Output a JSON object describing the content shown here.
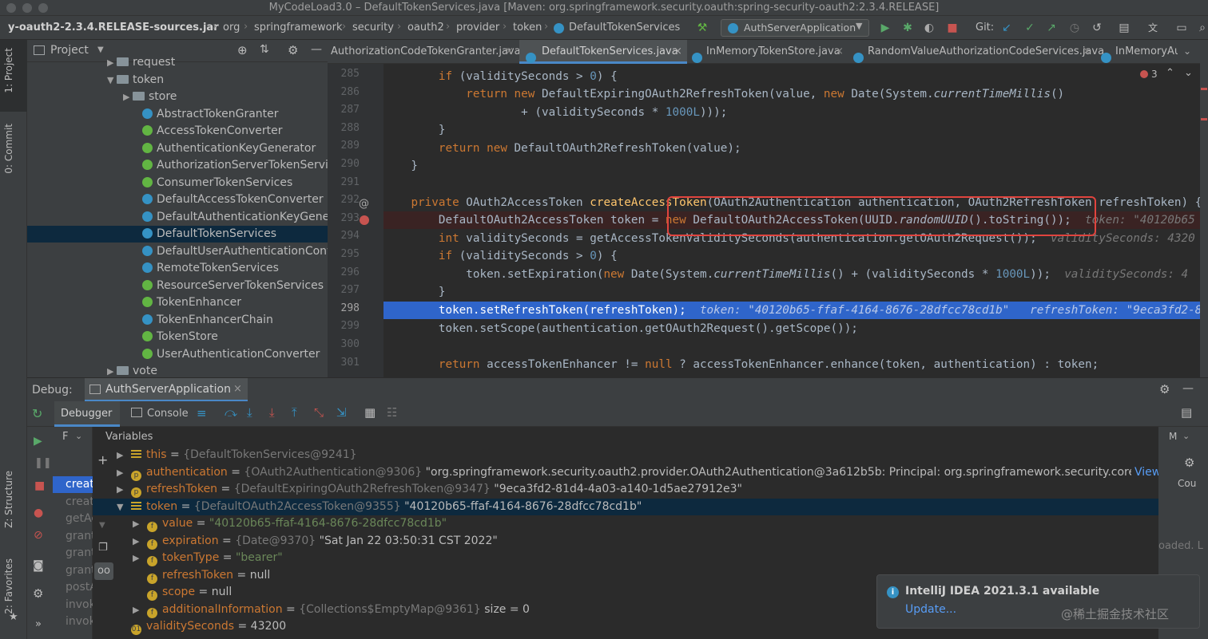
{
  "window": {
    "title": "MyCodeLoad3.0 – DefaultTokenServices.java [Maven: org.springframework.security.oauth:spring-security-oauth2:2.3.4.RELEASE]"
  },
  "breadcrumbs": [
    "y-oauth2-2.3.4.RELEASE-sources.jar",
    "org",
    "springframework",
    "security",
    "oauth2",
    "provider",
    "token",
    "DefaultTokenServices"
  ],
  "toolbar": {
    "run_config": "AuthServerApplication",
    "git_label": "Git:"
  },
  "side_tabs": {
    "project": "1: Project",
    "commit": "0: Commit",
    "structure": "Z: Structure",
    "favorites": "2: Favorites"
  },
  "project": {
    "title": "Project",
    "tree": [
      {
        "label": "request",
        "type": "folder",
        "indent": 1,
        "arrow": "▶"
      },
      {
        "label": "token",
        "type": "folder",
        "indent": 1,
        "arrow": "▼"
      },
      {
        "label": "store",
        "type": "folder",
        "indent": 2,
        "arrow": "▶"
      },
      {
        "label": "AbstractTokenGranter",
        "type": "class",
        "indent": 3
      },
      {
        "label": "AccessTokenConverter",
        "type": "interface",
        "indent": 3
      },
      {
        "label": "AuthenticationKeyGenerator",
        "type": "interface",
        "indent": 3
      },
      {
        "label": "AuthorizationServerTokenServic",
        "type": "interface",
        "indent": 3
      },
      {
        "label": "ConsumerTokenServices",
        "type": "interface",
        "indent": 3
      },
      {
        "label": "DefaultAccessTokenConverter",
        "type": "class",
        "indent": 3
      },
      {
        "label": "DefaultAuthenticationKeyGener",
        "type": "class",
        "indent": 3
      },
      {
        "label": "DefaultTokenServices",
        "type": "class",
        "indent": 3,
        "selected": true
      },
      {
        "label": "DefaultUserAuthenticationConv",
        "type": "class",
        "indent": 3
      },
      {
        "label": "RemoteTokenServices",
        "type": "class",
        "indent": 3
      },
      {
        "label": "ResourceServerTokenServices",
        "type": "interface",
        "indent": 3
      },
      {
        "label": "TokenEnhancer",
        "type": "interface",
        "indent": 3
      },
      {
        "label": "TokenEnhancerChain",
        "type": "class",
        "indent": 3
      },
      {
        "label": "TokenStore",
        "type": "interface",
        "indent": 3
      },
      {
        "label": "UserAuthenticationConverter",
        "type": "interface",
        "indent": 3
      },
      {
        "label": "vote",
        "type": "folder",
        "indent": 1,
        "arrow": "▶"
      }
    ]
  },
  "editor": {
    "tabs": [
      {
        "label": "AuthorizationCodeTokenGranter.java",
        "active": false
      },
      {
        "label": "DefaultTokenServices.java",
        "active": true
      },
      {
        "label": "InMemoryTokenStore.java",
        "active": false
      },
      {
        "label": "RandomValueAuthorizationCodeServices.java",
        "active": false
      },
      {
        "label": "InMemoryAu",
        "active": false
      }
    ],
    "warning_count": "3",
    "line_numbers": [
      "285",
      "286",
      "287",
      "288",
      "289",
      "290",
      "291",
      "292",
      "293",
      "294",
      "295",
      "296",
      "297",
      "298",
      "299",
      "300",
      "301"
    ],
    "current_line": "298",
    "breakpoint_line": "293"
  },
  "debug": {
    "label": "Debug:",
    "session": "AuthServerApplication",
    "tabs": {
      "debugger": "Debugger",
      "console": "Console"
    },
    "variables_title": "Variables",
    "frames_header": "F",
    "frames": [
      "creat",
      "creat",
      "getAc",
      "grant",
      "grant",
      "grant",
      "postA",
      "invok",
      "invok"
    ],
    "variables": [
      {
        "indent": 0,
        "arrow": "▶",
        "icon": "list",
        "name": "this",
        "type": "{DefaultTokenServices@9241}",
        "value": ""
      },
      {
        "indent": 0,
        "arrow": "▶",
        "icon": "p",
        "name": "authentication",
        "type": "{OAuth2Authentication@9306}",
        "value": "\"org.springframework.security.oauth2.provider.OAuth2Authentication@3a612b5b: Principal: org.springframework.security.core.u...",
        "link": "View"
      },
      {
        "indent": 0,
        "arrow": "▶",
        "icon": "p",
        "name": "refreshToken",
        "type": "{DefaultExpiringOAuth2RefreshToken@9347}",
        "value": "\"9eca3fd2-81d4-4a03-a140-1d5ae27912e3\""
      },
      {
        "indent": 0,
        "arrow": "▼",
        "icon": "list",
        "name": "token",
        "type": "{DefaultOAuth2AccessToken@9355}",
        "value": "\"40120b65-ffaf-4164-8676-28dfcc78cd1b\"",
        "selected": true
      },
      {
        "indent": 1,
        "arrow": "▶",
        "icon": "f",
        "name": "value",
        "type": "",
        "value": "\"40120b65-ffaf-4164-8676-28dfcc78cd1b\"",
        "green": true
      },
      {
        "indent": 1,
        "arrow": "▶",
        "icon": "f",
        "name": "expiration",
        "type": "{Date@9370}",
        "value": "\"Sat Jan 22 03:50:31 CST 2022\""
      },
      {
        "indent": 1,
        "arrow": "▶",
        "icon": "f",
        "name": "tokenType",
        "type": "",
        "value": "\"bearer\"",
        "green": true
      },
      {
        "indent": 1,
        "arrow": "",
        "icon": "f",
        "name": "refreshToken",
        "type": "",
        "value": "null"
      },
      {
        "indent": 1,
        "arrow": "",
        "icon": "f",
        "name": "scope",
        "type": "",
        "value": "null"
      },
      {
        "indent": 1,
        "arrow": "▶",
        "icon": "f",
        "name": "additionalInformation",
        "type": "{Collections$EmptyMap@9361}",
        "value": " size = 0"
      },
      {
        "indent": 0,
        "arrow": "",
        "icon": "o1",
        "name": "validitySeconds",
        "type": "",
        "value": "43200"
      }
    ],
    "right_labels": {
      "m": "M",
      "cou": "Cou",
      "loaded": "oaded. L"
    }
  },
  "notification": {
    "title": "IntelliJ IDEA 2021.3.1 available",
    "link": "Update..."
  },
  "watermark": "@稀土掘金技术社区",
  "colors": {
    "keyword": "#cc7832",
    "method": "#ffc66d",
    "number": "#6897bb",
    "string": "#6a8759",
    "selection": "#2f65ca",
    "highlight_box": "#e0443e"
  }
}
